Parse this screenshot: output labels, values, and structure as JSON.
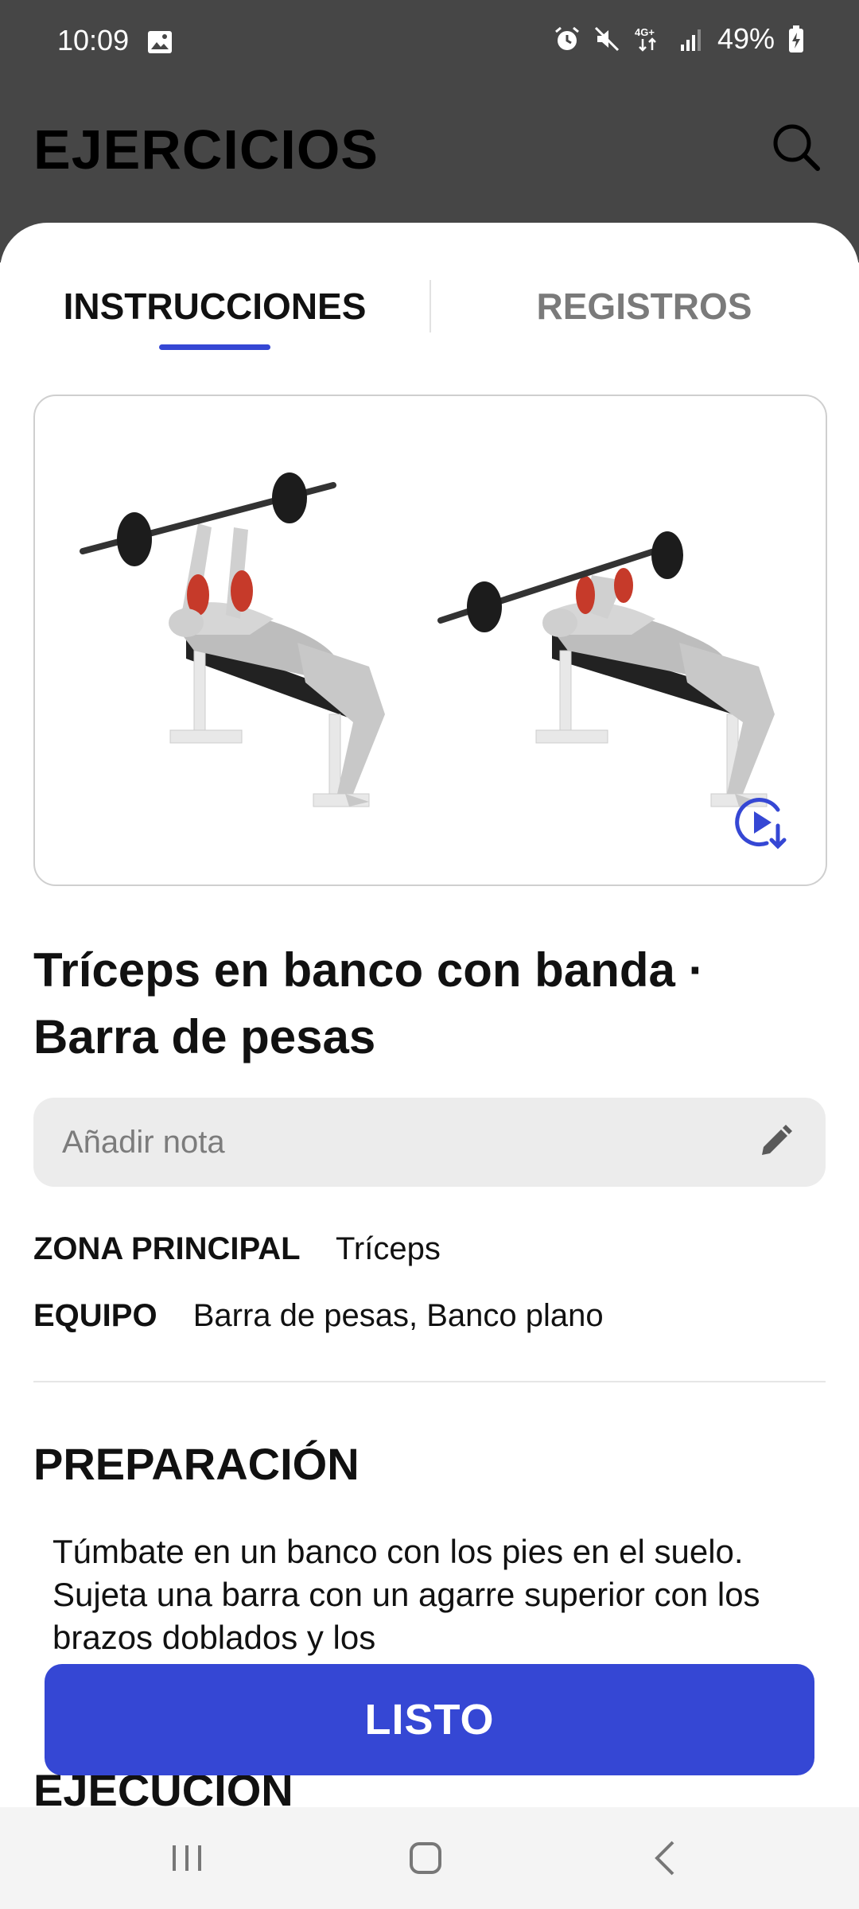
{
  "status_bar": {
    "time": "10:09",
    "network": "4G+",
    "battery": "49%"
  },
  "header": {
    "title": "EJERCICIOS"
  },
  "tabs": [
    {
      "label": "INSTRUCCIONES",
      "active": true
    },
    {
      "label": "REGISTROS",
      "active": false
    }
  ],
  "exercise": {
    "title_line1": "Tríceps en banco con banda ·",
    "title_line2": "Barra de pesas",
    "note_placeholder": "Añadir nota",
    "main_zone_label": "ZONA PRINCIPAL",
    "main_zone_value": "Tríceps",
    "equipment_label": "EQUIPO",
    "equipment_value": "Barra de pesas, Banco plano"
  },
  "sections": {
    "preparation_title": "PREPARACIÓN",
    "preparation_text": "Túmbate en un banco con los pies en el suelo. Sujeta una barra con un agarre superior con los brazos doblados y los",
    "execution_title": "EJECUCIÓN"
  },
  "primary_action": {
    "label": "LISTO"
  },
  "icons": {
    "search": "search-icon",
    "video": "video-download-icon",
    "pencil": "pencil-icon"
  },
  "colors": {
    "accent": "#3547d4",
    "topbar": "#464646"
  }
}
